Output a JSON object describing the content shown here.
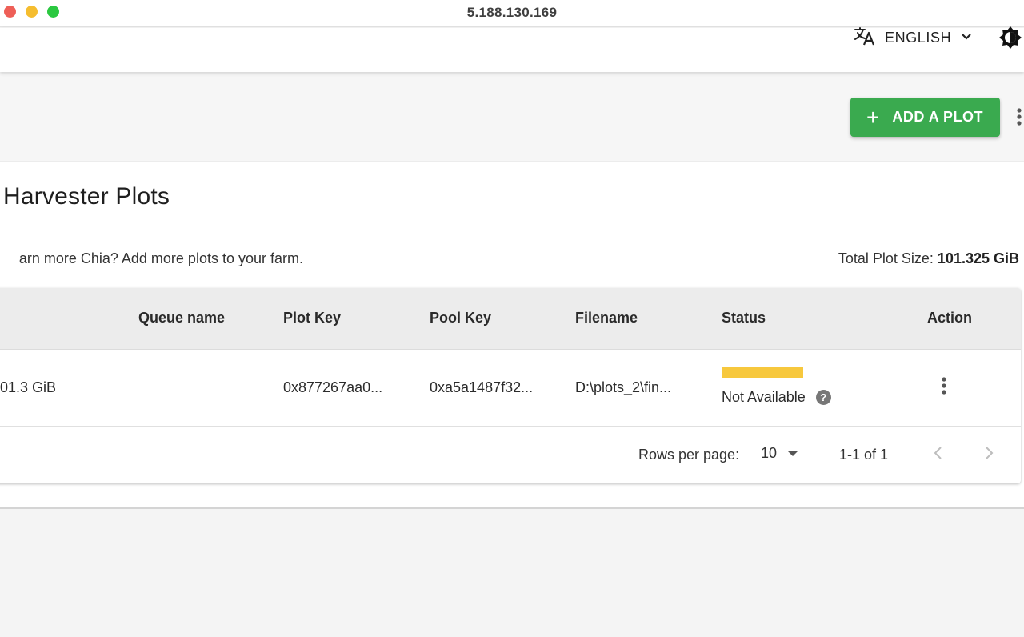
{
  "window": {
    "title": "5.188.130.169"
  },
  "appbar": {
    "language_label": "ENGLISH",
    "icons": [
      "translate-icon",
      "chevron-down-icon",
      "brightness-icon"
    ]
  },
  "toolbar": {
    "add_plot_label": "ADD A PLOT",
    "add_plot_icon": "plus-icon",
    "more_icon": "more-vert-icon"
  },
  "page": {
    "title": "Harvester Plots",
    "subtitle": "arn more Chia? Add more plots to your farm.",
    "total_label": "Total Plot Size:",
    "total_value": "101.325 GiB"
  },
  "table": {
    "columns": [
      "Queue name",
      "Plot Key",
      "Pool Key",
      "Filename",
      "Status",
      "Action"
    ],
    "rows": [
      {
        "size": "01.3 GiB",
        "queue_name": "",
        "plot_key": "0x877267aa0...",
        "pool_key": "0xa5a1487f32...",
        "filename": "D:\\plots_2\\fin...",
        "status": "Not Available",
        "status_color": "#f7c83d"
      }
    ],
    "pagination": {
      "rows_per_page_label": "Rows per page:",
      "rows_per_page_value": "10",
      "range": "1-1 of 1"
    }
  },
  "colors": {
    "accent_green": "#3aaa4f",
    "status_yellow": "#f7c83d"
  }
}
